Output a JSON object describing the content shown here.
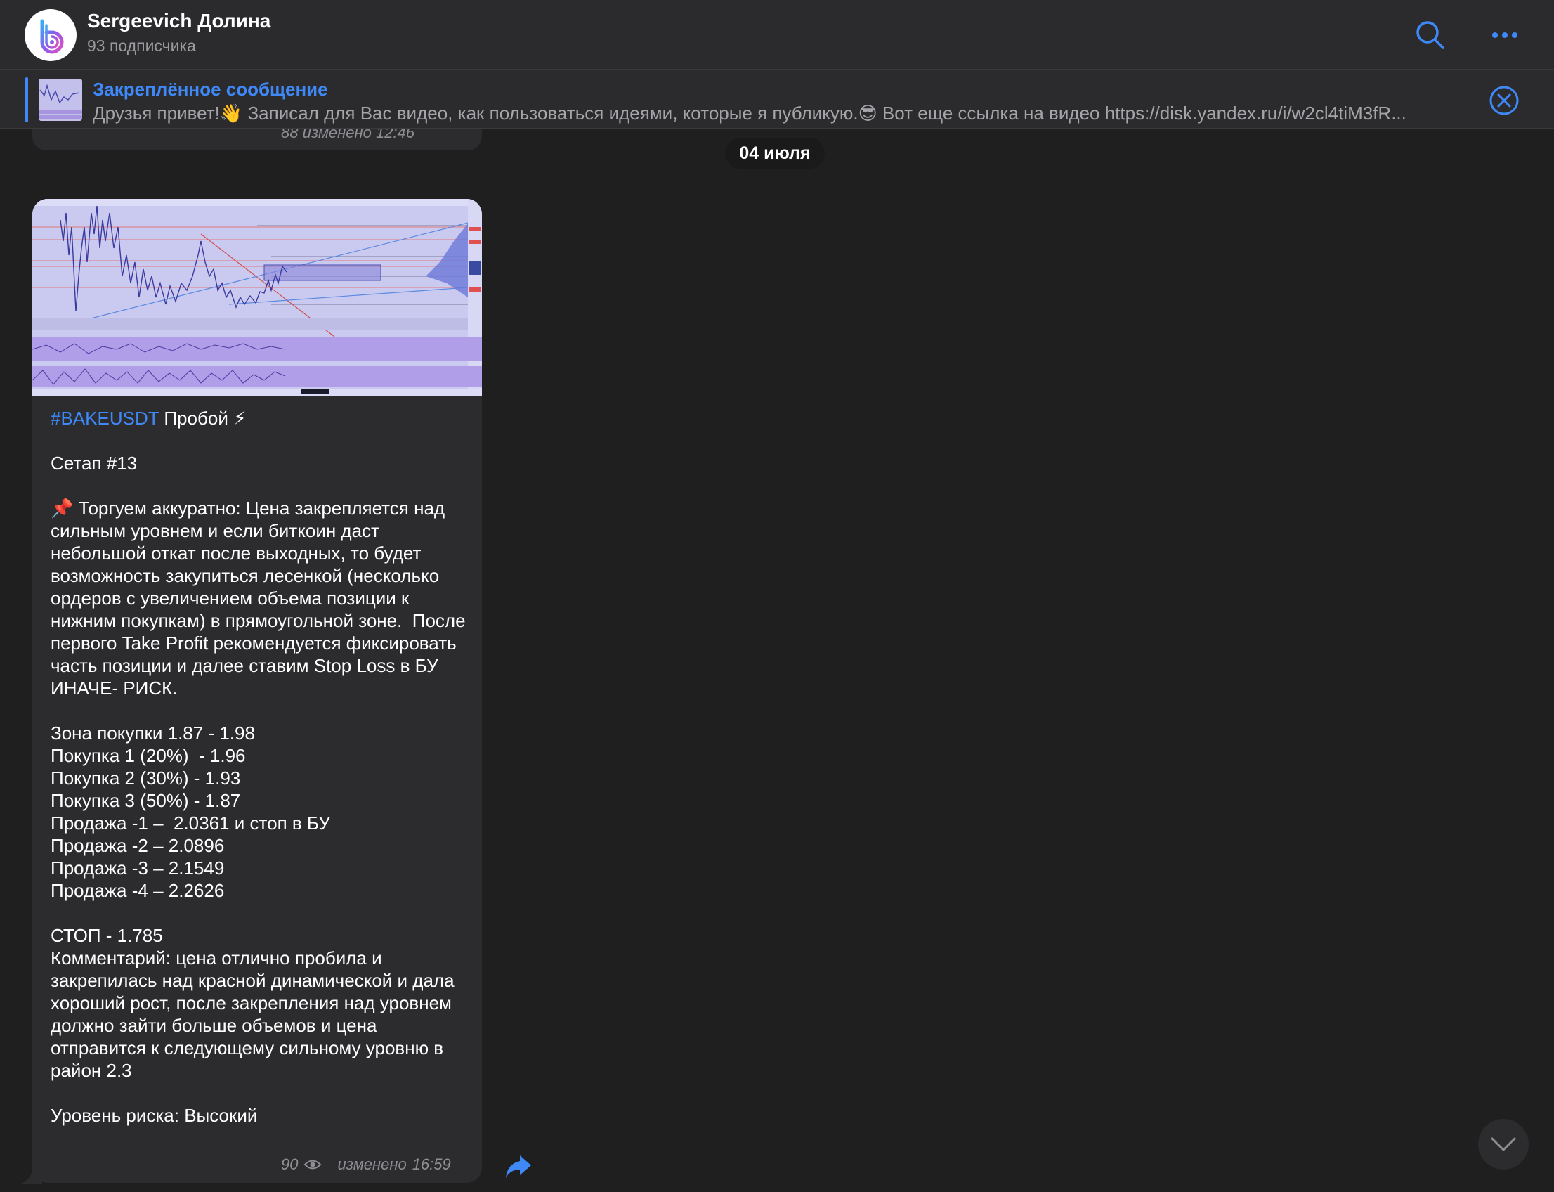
{
  "header": {
    "title": "Sergeevich Долина",
    "subtitle": "93 подписчика",
    "icons": {
      "avatar": "channel-logo",
      "search": "search-icon",
      "more": "more-icon"
    }
  },
  "pinned": {
    "title": "Закреплённое сообщение",
    "text": "Друзья привет!👋 Записал для Вас видео, как пользоваться идеями, которые я публикую.😎 Вот еще ссылка на видео https://disk.yandex.ru/i/w2cl4tiM3fR..."
  },
  "previous_message": {
    "views": "88",
    "edited_label": "изменено",
    "time": "12:46"
  },
  "date_chip": "04 июля",
  "message": {
    "hashtag": "#BAKEUSDT",
    "headline": " Пробой ⚡",
    "setup": "Сетап #13",
    "warning": "📌 Торгуем аккуратно: Цена закрепляется над сильным уровнем и если биткоин даст небольшой откат после выходных, то будет возможность закупиться лесенкой (несколько ордеров с увеличением объема позиции к нижним покупкам) в прямоугольной зоне.  После первого Take Profit рекомендуется фиксировать часть позиции и далее ставим Stop Loss в БУ ИНАЧЕ- РИСК.",
    "levels": [
      "Зона покупки 1.87 - 1.98",
      "Покупка 1 (20%)  - 1.96",
      "Покупка 2 (30%) - 1.93",
      "Покупка 3 (50%) - 1.87",
      "Продажа -1 –  2.0361 и стоп в БУ",
      "Продажа -2 – 2.0896",
      "Продажа -3 – 2.1549",
      "Продажа -4 – 2.2626"
    ],
    "stop": "СТОП - 1.785",
    "comment": "Комментарий: цена отлично пробила и закрепилась над красной динамической и дала хороший рост, после закрепления над уровнем должно зайти больше объемов и цена отправится к следующему сильному уровню в район 2.3",
    "risk": "Уровень риска: Высокий",
    "views": "90",
    "edited_label": "изменено",
    "time": "16:59"
  },
  "colors": {
    "accent": "#3e88f7",
    "background": "#1f1f1f",
    "bubble": "#2c2c2e",
    "header": "#2b2b2d"
  }
}
